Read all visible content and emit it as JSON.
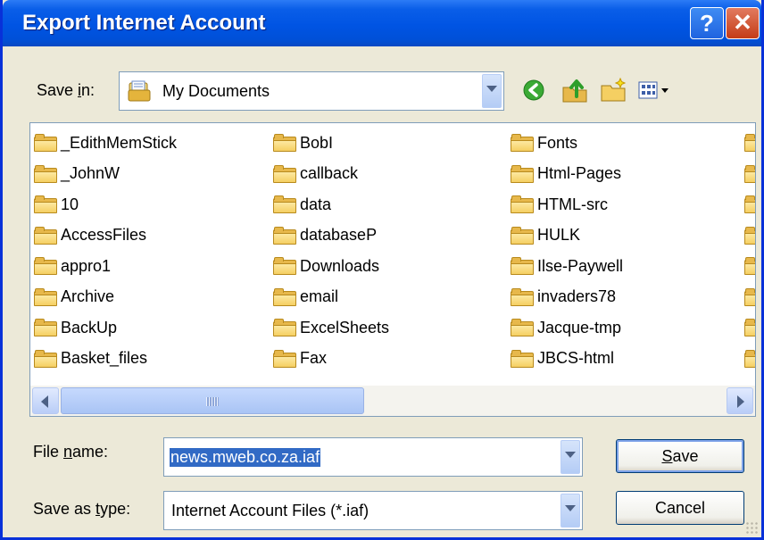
{
  "window": {
    "title": "Export Internet Account",
    "help_glyph": "?",
    "close_glyph": "✕",
    "colors": {
      "titlebar": "#0054E3",
      "face": "#ECE9D8",
      "selection": "#316AC5"
    }
  },
  "save_in": {
    "label_pre": "Save ",
    "label_accel": "i",
    "label_post": "n:",
    "value": "My Documents",
    "icon": "my-documents-icon"
  },
  "toolbar": {
    "icons": [
      "back-icon",
      "up-folder-icon",
      "new-folder-icon",
      "view-menu-icon"
    ]
  },
  "files": {
    "columns": [
      [
        "_EdithMemStick",
        "_JohnW",
        "10",
        "AccessFiles",
        "appro1",
        "Archive",
        "BackUp",
        "Basket_files"
      ],
      [
        "BobI",
        "callback",
        "data",
        "databaseP",
        "Downloads",
        "email",
        "ExcelSheets",
        "Fax"
      ],
      [
        "Fonts",
        "Html-Pages",
        "HTML-src",
        "HULK",
        "Ilse-Paywell",
        "invaders78",
        "Jacque-tmp",
        "JBCS-html"
      ]
    ],
    "item_icon": "folder-icon",
    "scroll_position": 0.0
  },
  "file_name": {
    "label_pre": "File ",
    "label_accel": "n",
    "label_post": "ame:",
    "value": "news.mweb.co.za.iaf"
  },
  "save_as_type": {
    "label_pre": "Save as ",
    "label_accel": "t",
    "label_post": "ype:",
    "value": "Internet Account Files (*.iaf)"
  },
  "buttons": {
    "save_accel": "S",
    "save_rest": "ave",
    "cancel": "Cancel"
  }
}
